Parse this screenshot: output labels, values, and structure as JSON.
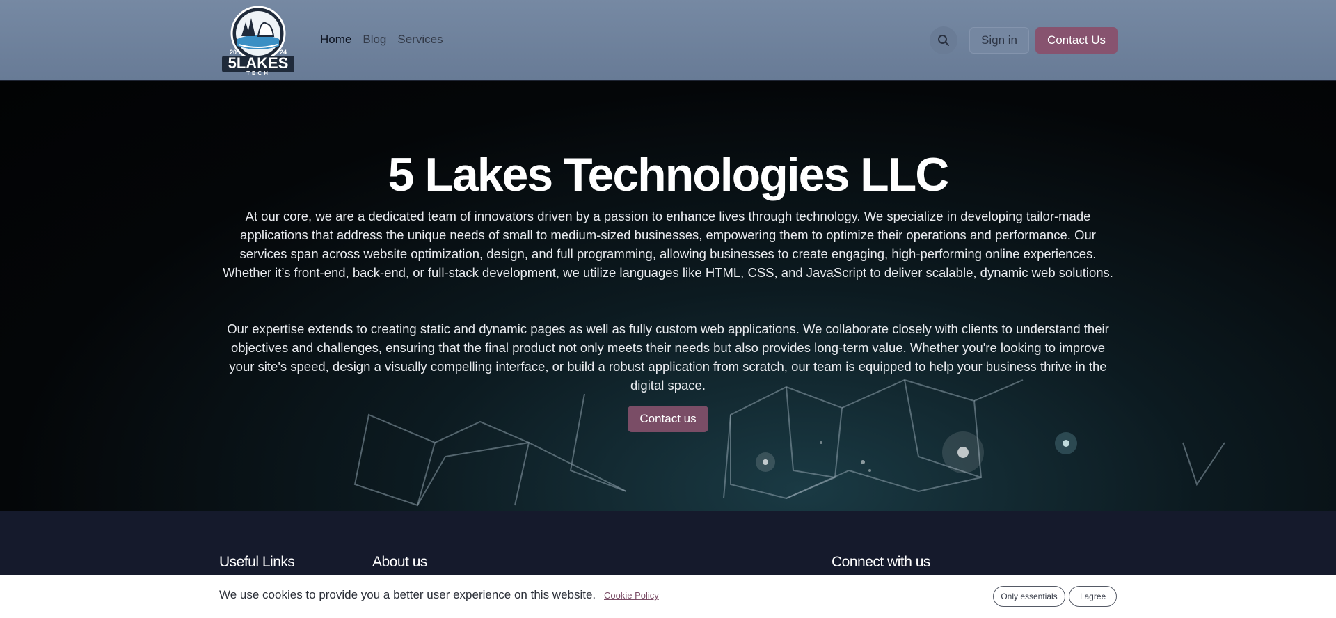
{
  "header": {
    "logo_alt": "5 Lakes Tech logo",
    "logo_text": "5LAKES",
    "logo_sub": "TECH",
    "logo_year_left": "20",
    "logo_year_right": "24",
    "nav": [
      {
        "label": "Home",
        "active": true
      },
      {
        "label": "Blog",
        "active": false
      },
      {
        "label": "Services",
        "active": false
      }
    ],
    "search_icon": "search-icon",
    "signin_label": "Sign in",
    "contact_label": "Contact Us"
  },
  "hero": {
    "title": "5 Lakes Technologies LLC",
    "paragraph1": "At our core, we are a dedicated team of innovators driven by a passion to enhance lives through technology. We specialize in developing tailor-made applications that address the unique needs of small to medium-sized businesses, empowering them to optimize their operations and performance. Our services span across website optimization, design, and full programming, allowing businesses to create engaging, high-performing online experiences. Whether it’s front-end, back-end, or full-stack development, we utilize languages like HTML, CSS, and JavaScript to deliver scalable, dynamic web solutions.",
    "paragraph2": "Our expertise extends to creating static and dynamic pages as well as fully custom web applications. We collaborate closely with clients to understand their objectives and challenges, ensuring that the final product not only meets their needs but also provides long-term value. Whether you're looking to improve your site's speed, design a visually compelling interface, or build a robust application from scratch, our team is equipped to help your business thrive in the digital space.",
    "cta_label": "Contact us"
  },
  "footer": {
    "useful_links_title": "Useful Links",
    "about_title": "About us",
    "connect_title": "Connect with us"
  },
  "cookie": {
    "message": "We use cookies to provide you a better user experience on this website.",
    "policy_link": "Cookie Policy",
    "essentials_label": "Only essentials",
    "agree_label": "I agree"
  },
  "colors": {
    "header_bg": "#6e819b",
    "accent": "#87536f",
    "footer_bg": "#151a2c"
  }
}
